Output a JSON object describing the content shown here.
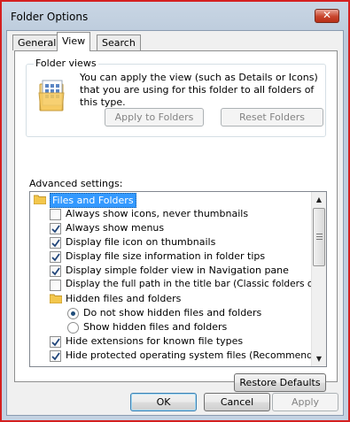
{
  "window": {
    "title": "Folder Options",
    "close_glyph": "✕"
  },
  "tabs": [
    {
      "label": "General",
      "active": false
    },
    {
      "label": "View",
      "active": true
    },
    {
      "label": "Search",
      "active": false
    }
  ],
  "folder_views": {
    "legend": "Folder views",
    "description": "You can apply the view (such as Details or Icons) that you are using for this folder to all folders of this type.",
    "apply_button": "Apply to Folders",
    "reset_button": "Reset Folders"
  },
  "advanced": {
    "label": "Advanced settings:",
    "items": [
      {
        "type": "folder",
        "label": "Files and Folders",
        "selected": true
      },
      {
        "type": "checkbox",
        "label": "Always show icons, never thumbnails",
        "checked": false
      },
      {
        "type": "checkbox",
        "label": "Always show menus",
        "checked": true
      },
      {
        "type": "checkbox",
        "label": "Display file icon on thumbnails",
        "checked": true
      },
      {
        "type": "checkbox",
        "label": "Display file size information in folder tips",
        "checked": true
      },
      {
        "type": "checkbox",
        "label": "Display simple folder view in Navigation pane",
        "checked": true
      },
      {
        "type": "checkbox",
        "label": "Display the full path in the title bar (Classic folders only)",
        "checked": false
      },
      {
        "type": "folder",
        "label": "Hidden files and folders",
        "selected": false
      },
      {
        "type": "radio",
        "label": "Do not show hidden files and folders",
        "checked": true
      },
      {
        "type": "radio",
        "label": "Show hidden files and folders",
        "checked": false
      },
      {
        "type": "checkbox",
        "label": "Hide extensions for known file types",
        "checked": true
      },
      {
        "type": "checkbox",
        "label": "Hide protected operating system files (Recommended)",
        "checked": true
      }
    ]
  },
  "restore_button": "Restore Defaults",
  "footer": {
    "ok": "OK",
    "cancel": "Cancel",
    "apply": "Apply"
  },
  "icons": {
    "close": "close-icon",
    "folder": "folder-icon",
    "check": "checkmark-icon",
    "scroll_up": "scroll-up-arrow-icon",
    "scroll_down": "scroll-down-arrow-icon"
  },
  "colors": {
    "selection": "#3399ff",
    "window_border": "#d42020",
    "close_button": "#c8442c"
  }
}
